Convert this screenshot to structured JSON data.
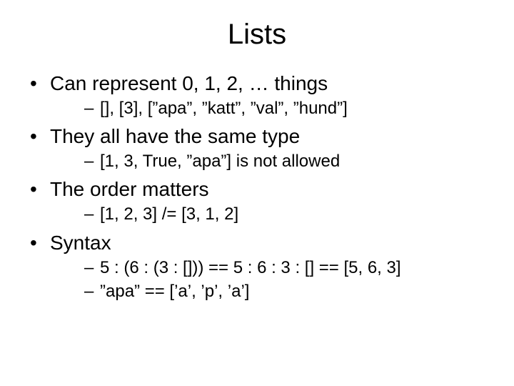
{
  "title": "Lists",
  "bullets": [
    {
      "text": "Can represent 0, 1, 2, … things",
      "sub": [
        "[], [3], [”apa”, ”katt”, ”val”, ”hund”]"
      ]
    },
    {
      "text": "They all have the same type",
      "sub": [
        "[1, 3, True, ”apa”] is not allowed"
      ]
    },
    {
      "text": "The order matters",
      "sub": [
        "[1, 2, 3] /= [3, 1, 2]"
      ]
    },
    {
      "text": "Syntax",
      "sub": [
        "5 : (6 : (3 : [])) == 5 : 6 : 3 : [] == [5, 6, 3]",
        "”apa” == [’a’, ’p’, ’a’]"
      ]
    }
  ]
}
